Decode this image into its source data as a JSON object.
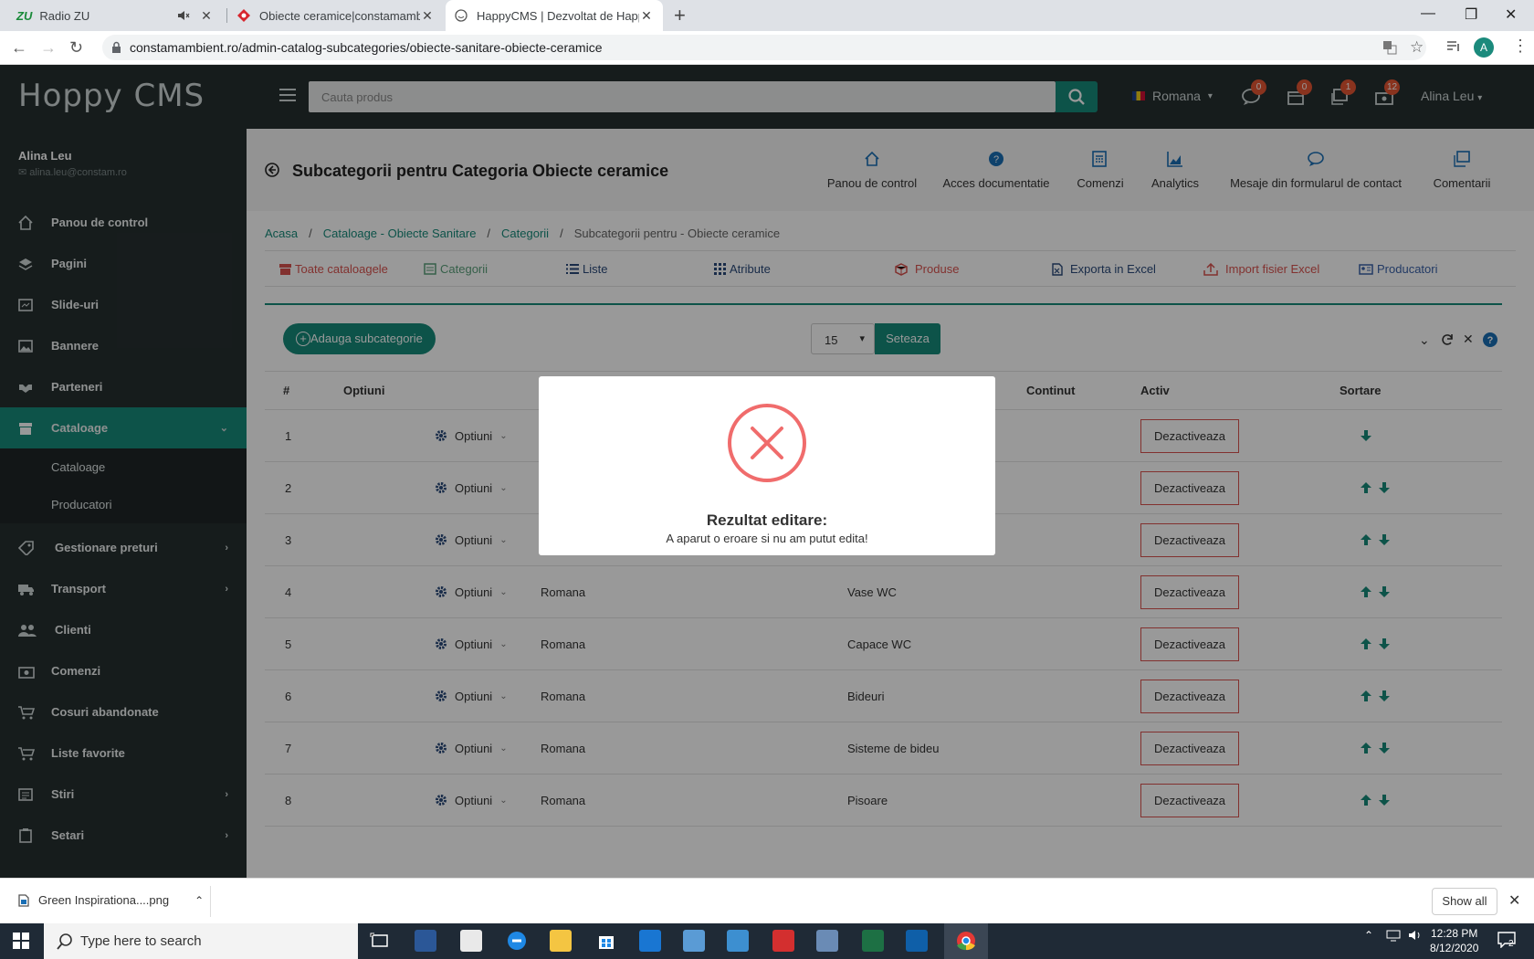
{
  "browser": {
    "tabs": [
      {
        "title": "Radio ZU",
        "icon_text": "ZU"
      },
      {
        "title": "Obiecte ceramice|constamambient"
      },
      {
        "title": "HappyCMS | Dezvoltat de Happy"
      }
    ],
    "url": "constamambient.ro/admin-catalog-subcategories/obiecte-sanitare-obiecte-ceramice",
    "avatar": "A"
  },
  "topbar": {
    "logo": "Hoppy CMS",
    "search_placeholder": "Cauta produs",
    "language": "Romana",
    "badges": [
      "0",
      "0",
      "1",
      "12"
    ],
    "user": "Alina Leu"
  },
  "sidebar": {
    "user_name": "Alina Leu",
    "user_email": "alina.leu@constam.ro",
    "items": [
      {
        "label": "Panou de control"
      },
      {
        "label": "Pagini"
      },
      {
        "label": "Slide-uri"
      },
      {
        "label": "Bannere"
      },
      {
        "label": "Parteneri"
      },
      {
        "label": "Cataloage"
      },
      {
        "label": "Gestionare preturi"
      },
      {
        "label": "Transport"
      },
      {
        "label": "Clienti"
      },
      {
        "label": "Comenzi"
      },
      {
        "label": "Cosuri abandonate"
      },
      {
        "label": "Liste favorite"
      },
      {
        "label": "Stiri"
      },
      {
        "label": "Setari"
      }
    ],
    "submenu": [
      "Cataloage",
      "Producatori"
    ]
  },
  "page": {
    "title": "Subcategorii pentru Categoria Obiecte ceramice",
    "quicklinks": [
      "Panou de control",
      "Acces documentatie",
      "Comenzi",
      "Analytics",
      "Mesaje din formularul de contact",
      "Comentarii"
    ],
    "breadcrumb": [
      "Acasa",
      "Cataloage - Obiecte Sanitare",
      "Categorii",
      "Subcategorii pentru - Obiecte ceramice"
    ],
    "catalog_tabs": [
      "Toate cataloagele",
      "Categorii",
      "Liste",
      "Atribute",
      "Produse",
      "Exporta in Excel",
      "Import fisier Excel",
      "Producatori"
    ],
    "add_button": "Adauga subcategorie",
    "per_page": "15",
    "set_button": "Seteaza",
    "columns": [
      "#",
      "Optiuni",
      "Continut",
      "Activ",
      "Sortare"
    ],
    "options_label": "Optiuni",
    "deactivate_label": "Dezactiveaza",
    "rows": [
      {
        "n": "1",
        "lang": "",
        "content": ""
      },
      {
        "n": "2",
        "lang": "",
        "content": ""
      },
      {
        "n": "3",
        "lang": "",
        "content": ""
      },
      {
        "n": "4",
        "lang": "Romana",
        "content": "Vase WC"
      },
      {
        "n": "5",
        "lang": "Romana",
        "content": "Capace WC"
      },
      {
        "n": "6",
        "lang": "Romana",
        "content": "Bideuri"
      },
      {
        "n": "7",
        "lang": "Romana",
        "content": "Sisteme de bideu"
      },
      {
        "n": "8",
        "lang": "Romana",
        "content": "Pisoare"
      }
    ]
  },
  "modal": {
    "title": "Rezultat editare:",
    "message": "A aparut o eroare si nu am putut edita!"
  },
  "download": {
    "file": "Green Inspirationa....png",
    "show_all": "Show all"
  },
  "taskbar": {
    "search_placeholder": "Type here to search",
    "time": "12:28 PM",
    "date": "8/12/2020",
    "notifications": "2"
  },
  "colors": {
    "accent": "#178a7a",
    "sidebar": "#262f30",
    "danger": "#d9534f"
  }
}
